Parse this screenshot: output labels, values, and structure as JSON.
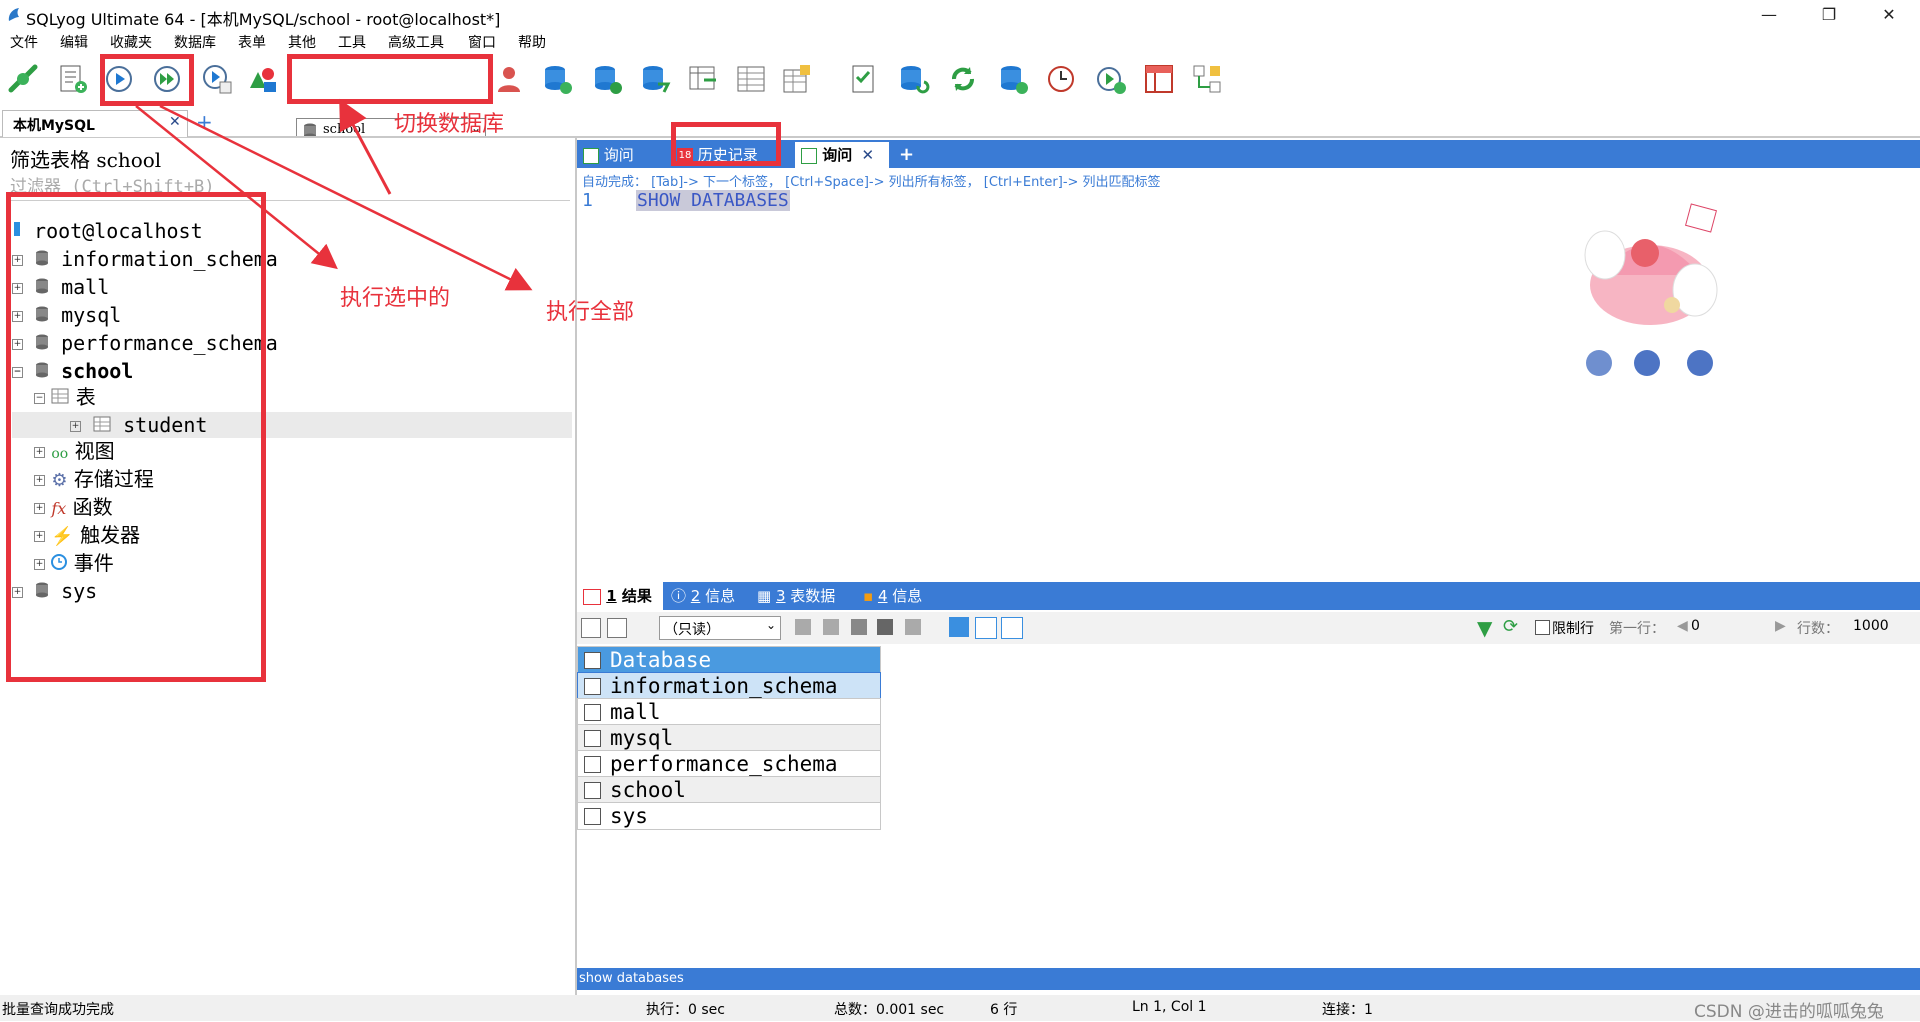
{
  "window": {
    "title": "SQLyog Ultimate 64 - [本机MySQL/school - root@localhost*]",
    "minimize": "—",
    "restore": "❐",
    "close": "✕"
  },
  "menu": [
    "文件",
    "编辑",
    "收藏夹",
    "数据库",
    "表单",
    "其他",
    "工具",
    "高级工具",
    "窗口",
    "帮助"
  ],
  "toolbar": {
    "db_selector_value": "school"
  },
  "connection_tab": {
    "label": "本机MySQL",
    "close": "✕",
    "add": "+"
  },
  "left_pane": {
    "filter_title": "筛选表格 school",
    "filter_placeholder": "过滤器  (Ctrl+Shift+B)",
    "tree": {
      "root": "root@localhost",
      "databases": [
        "information_schema",
        "mall",
        "mysql",
        "performance_schema"
      ],
      "active_db": "school",
      "tables_folder": "表",
      "table": "student",
      "folders": [
        "视图",
        "存储过程",
        "函数",
        "触发器",
        "事件"
      ],
      "last_db": "sys"
    }
  },
  "editor": {
    "tabs": [
      {
        "label": "询问"
      },
      {
        "label": "历史记录"
      },
      {
        "label": "询问"
      }
    ],
    "tab_close": "✕",
    "tab_add": "+",
    "hint": "自动完成： [Tab]-> 下一个标签， [Ctrl+Space]-> 列出所有标签， [Ctrl+Enter]-> 列出匹配标签",
    "line_number": "1",
    "code": "SHOW DATABASES",
    "status": "show databases"
  },
  "results": {
    "tabs": [
      {
        "num": "1",
        "label": "结果"
      },
      {
        "num": "2",
        "label": "信息"
      },
      {
        "num": "3",
        "label": "表数据"
      },
      {
        "num": "4",
        "label": "信息"
      }
    ],
    "mode": "（只读）",
    "limit_label": "限制行",
    "first_row_label": "第一行：",
    "first_row_value": "0",
    "rows_label": "行数：",
    "rows_value": "1000",
    "column": "Database",
    "rows": [
      "information_schema",
      "mall",
      "mysql",
      "performance_schema",
      "school",
      "sys"
    ]
  },
  "statusbar": {
    "message": "批量查询成功完成",
    "exec": "执行：0 sec",
    "total": "总数：0.001 sec",
    "rows": "6 行",
    "position": "Ln 1, Col 1",
    "connections": "连接：1",
    "watermark": "CSDN @进击的呱呱兔兔"
  },
  "annotations": {
    "switch_db": "切换数据库",
    "exec_selected": "执行选中的",
    "exec_all": "执行全部"
  },
  "colors": {
    "accent": "#3a7bd5",
    "annotation": "#e8323c",
    "selection": "#4a9ae0"
  }
}
